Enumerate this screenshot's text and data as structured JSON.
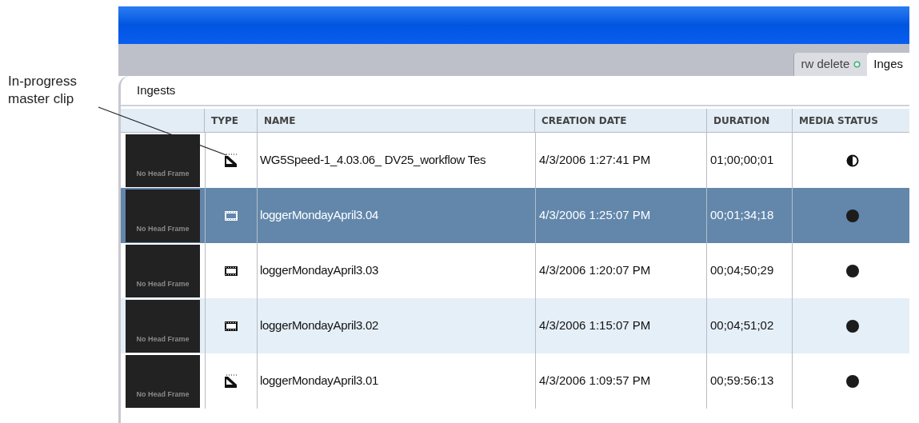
{
  "annotation": {
    "text": "In-progress master clip"
  },
  "tabs": [
    {
      "label": "rw delete",
      "selected": false,
      "indicator": true
    },
    {
      "label": "Inges",
      "selected": true,
      "indicator": false
    }
  ],
  "panel": {
    "title": "Ingests"
  },
  "table": {
    "columns": [
      "",
      "TYPE",
      "NAME",
      "CREATION DATE",
      "DURATION",
      "MEDIA STATUS"
    ],
    "rows": [
      {
        "thumbnail": "No Head Frame",
        "type": {
          "kind": "in_progress"
        },
        "name": "WG5Speed-1_4.03.06_ DV25_workflow Tes",
        "creation_date": "4/3/2006 1:27:41 PM",
        "duration": "01;00;00;01",
        "media_status": {
          "kind": "partial"
        },
        "selected": false
      },
      {
        "thumbnail": "No Head Frame",
        "type": {
          "kind": "master_clip"
        },
        "name": "loggerMondayApril3.04",
        "creation_date": "4/3/2006 1:25:07 PM",
        "duration": "00;01;34;18",
        "media_status": {
          "kind": "full"
        },
        "selected": true
      },
      {
        "thumbnail": "No Head Frame",
        "type": {
          "kind": "master_clip"
        },
        "name": "loggerMondayApril3.03",
        "creation_date": "4/3/2006 1:20:07 PM",
        "duration": "00;04;50;29",
        "media_status": {
          "kind": "full"
        },
        "selected": false
      },
      {
        "thumbnail": "No Head Frame",
        "type": {
          "kind": "master_clip"
        },
        "name": "loggerMondayApril3.02",
        "creation_date": "4/3/2006 1:15:07 PM",
        "duration": "00;04;51;02",
        "media_status": {
          "kind": "full"
        },
        "selected": false
      },
      {
        "thumbnail": "No Head Frame",
        "type": {
          "kind": "in_progress"
        },
        "name": "loggerMondayApril3.01",
        "creation_date": "4/3/2006 1:09:57 PM",
        "duration": "00;59:56:13",
        "media_status": {
          "kind": "full"
        },
        "selected": false
      }
    ]
  }
}
